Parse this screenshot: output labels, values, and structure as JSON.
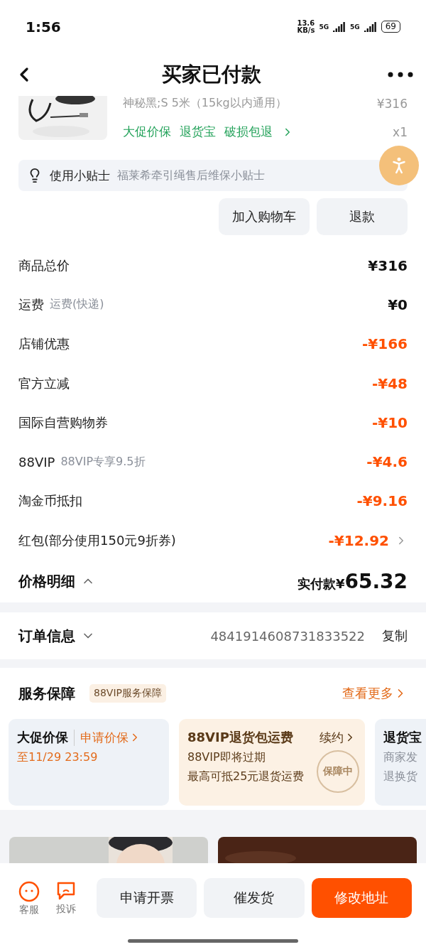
{
  "status_bar": {
    "time": "1:56",
    "speed": [
      "13.6",
      "KB/s"
    ],
    "networks": [
      "5G",
      "5G"
    ],
    "battery": "69"
  },
  "nav": {
    "title": "买家已付款"
  },
  "product": {
    "variant": "神秘黑;S 5米（15kg以内通用）",
    "price": "¥316",
    "quantity": "x1",
    "tags": [
      "大促价保",
      "退货宝",
      "破损包退"
    ]
  },
  "tip": {
    "label": "使用小贴士",
    "text": "福莱希牵引绳售后维保小贴士"
  },
  "actions": [
    "加入购物车",
    "退款"
  ],
  "price_rows": [
    {
      "label": "商品总价",
      "amount": "¥316",
      "kind": "normal"
    },
    {
      "label": "运费",
      "note": "运费(快递)",
      "amount": "¥0",
      "kind": "normal"
    },
    {
      "label": "店铺优惠",
      "amount": "-¥166",
      "kind": "discount"
    },
    {
      "label": "官方立减",
      "amount": "-¥48",
      "kind": "discount"
    },
    {
      "label": "国际自营购物券",
      "amount": "-¥10",
      "kind": "discount"
    },
    {
      "label": "88VIP",
      "note": "88VIP专享9.5折",
      "amount": "-¥4.6",
      "kind": "discount"
    },
    {
      "label": "淘金币抵扣",
      "amount": "-¥9.16",
      "kind": "discount"
    },
    {
      "label": "红包(部分使用150元9折券)",
      "amount": "-¥12.92",
      "kind": "link"
    }
  ],
  "total": {
    "label": "价格明细",
    "expanded": true,
    "paid_label": "实付款",
    "currency": "¥",
    "amount": "65.32"
  },
  "order": {
    "label": "订单信息",
    "expanded": false,
    "number": "4841914608731833522",
    "copy": "复制"
  },
  "service": {
    "title": "服务保障",
    "badge": "88VIP服务保障",
    "more": "查看更多",
    "cards": [
      {
        "kind": "promo",
        "title": "大促价保",
        "action": "申请价保",
        "lines": [
          "至11/29 23:59"
        ]
      },
      {
        "kind": "vip",
        "title": "88VIP退货包运费",
        "action": "续约",
        "stamp": "保障中",
        "lines": [
          "88VIP即将过期",
          "最高可抵25元退货运费"
        ]
      },
      {
        "kind": "plain",
        "title": "退货宝",
        "lines": [
          "商家发",
          "退换货"
        ]
      }
    ]
  },
  "banners": [
    {
      "kind": "picture"
    },
    {
      "kind": "picture"
    }
  ],
  "bottom": {
    "shortcuts": [
      {
        "kind": "service",
        "label": "客服"
      },
      {
        "kind": "complaint",
        "label": "投诉"
      }
    ],
    "buttons": [
      {
        "label": "申请开票",
        "primary": false
      },
      {
        "label": "催发货",
        "primary": false
      },
      {
        "label": "修改地址",
        "primary": true
      }
    ]
  }
}
